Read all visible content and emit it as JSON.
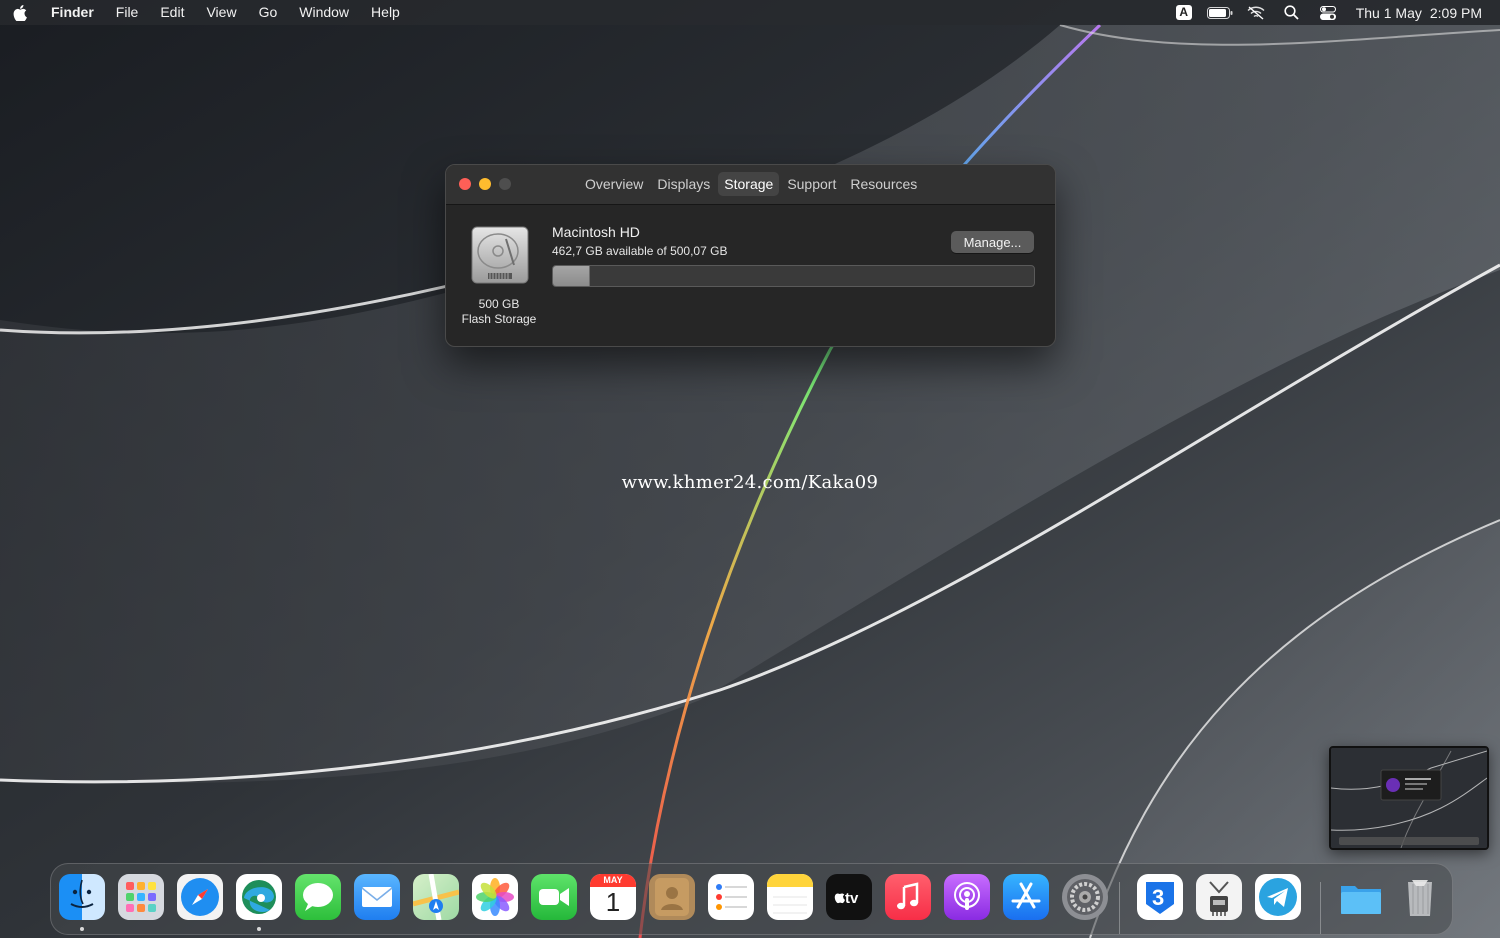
{
  "menubar": {
    "app_name": "Finder",
    "menus": [
      "File",
      "Edit",
      "View",
      "Go",
      "Window",
      "Help"
    ],
    "input_source": "A",
    "clock": {
      "date": "Thu 1 May",
      "time": "2:09 PM"
    }
  },
  "window": {
    "tabs": [
      "Overview",
      "Displays",
      "Storage",
      "Support",
      "Resources"
    ],
    "active_tab": "Storage",
    "disk": {
      "name": "Macintosh HD",
      "available": "462,7 GB available of 500,07 GB",
      "caption_size": "500 GB",
      "caption_type": "Flash Storage",
      "used_fraction": 0.075
    },
    "manage_label": "Manage..."
  },
  "watermark": "www.khmer24.com/Kaka09",
  "calendar": {
    "month": "MAY",
    "day": "1"
  },
  "dock": {
    "apps": [
      "finder-icon",
      "launchpad-icon",
      "safari-icon",
      "edge-icon",
      "messages-icon",
      "mail-icon",
      "maps-icon",
      "photos-icon",
      "facetime-icon",
      "calendar-icon",
      "contacts-icon",
      "reminders-icon",
      "notes-icon",
      "apple-tv-icon",
      "music-icon",
      "podcasts-icon",
      "app-store-icon",
      "system-preferences-icon",
      "3utools-icon",
      "system-information-icon",
      "telegram-icon",
      "downloads-folder-icon",
      "trash-icon"
    ]
  },
  "colors": {
    "traffic_red": "#fe5f57",
    "traffic_yellow": "#febc2e",
    "window_bg": "#262626"
  }
}
